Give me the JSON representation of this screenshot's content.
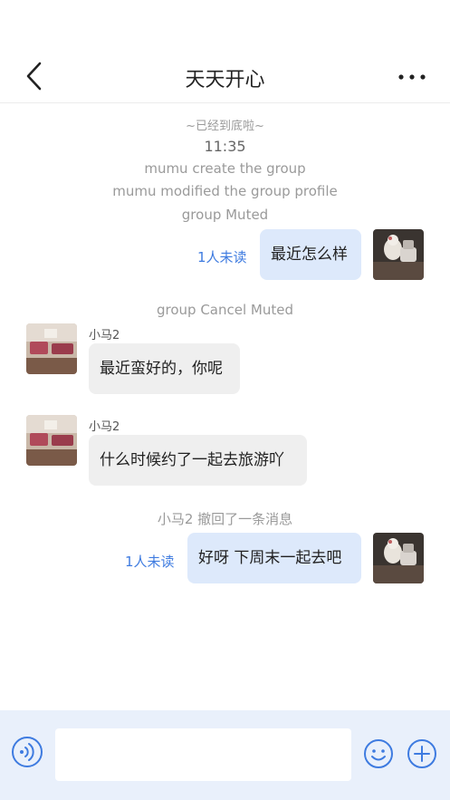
{
  "header": {
    "title": "天天开心"
  },
  "messages": {
    "top_hint": "~已经到底啦~",
    "time": "11:35",
    "sys_create": "mumu create the group",
    "sys_modify": "mumu modified the group profile",
    "sys_muted": "group Muted",
    "out1_text": "最近怎么样",
    "out1_read": "1人未读",
    "sys_unmuted": "group Cancel Muted",
    "in1_sender": "小马2",
    "in1_text": "最近蛮好的，你呢",
    "in2_sender": "小马2",
    "in2_text": "什么时候约了一起去旅游吖",
    "sys_recall": "小马2 撤回了一条消息",
    "out2_text": "好呀 下周末一起去吧",
    "out2_read": "1人未读"
  },
  "input": {
    "placeholder": ""
  },
  "icons": {
    "back": "chevron-left-icon",
    "more": "more-dots-icon",
    "voice": "voice-icon",
    "emoji": "emoji-icon",
    "plus": "plus-icon"
  },
  "colors": {
    "accent": "#3e7be0",
    "out_bubble": "#dde9fb",
    "in_bubble": "#efefef",
    "footer_bg": "#e9f0fb"
  }
}
